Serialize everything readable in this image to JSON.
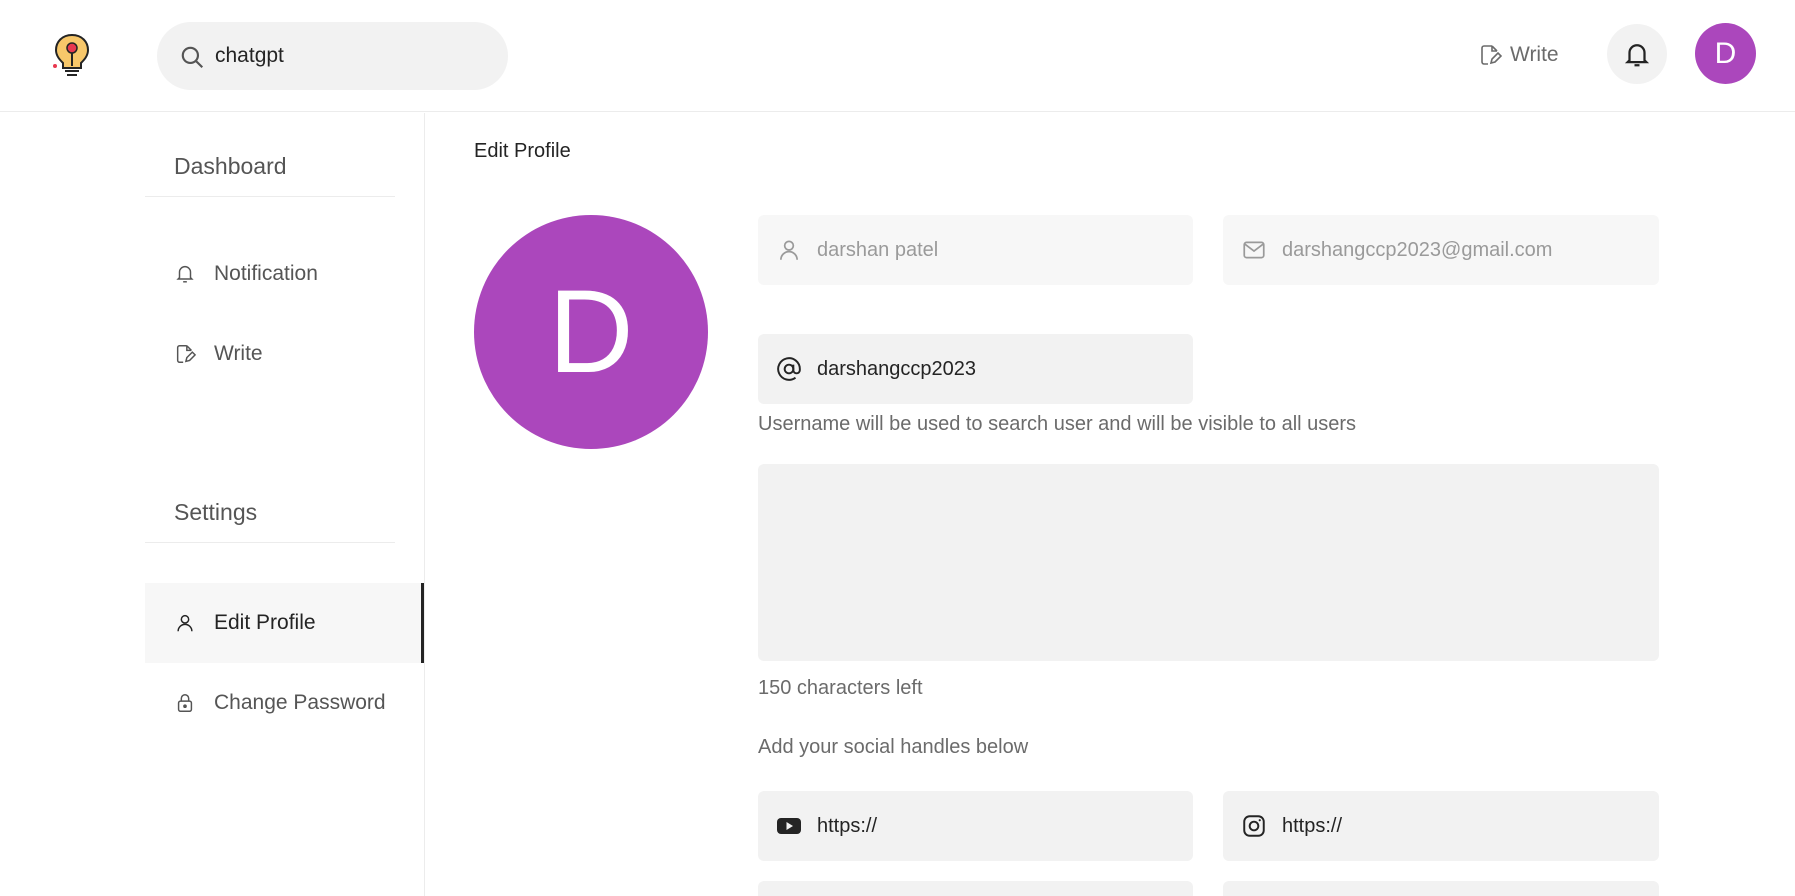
{
  "header": {
    "search": {
      "value": "chatgpt",
      "placeholder": "Search"
    },
    "write_label": "Write",
    "avatar_initial": "D"
  },
  "sidebar": {
    "dashboard_heading": "Dashboard",
    "dashboard_items": [
      {
        "label": "Notification",
        "icon": "bell-icon"
      },
      {
        "label": "Write",
        "icon": "write-icon"
      }
    ],
    "settings_heading": "Settings",
    "settings_items": [
      {
        "label": "Edit Profile",
        "icon": "user-icon",
        "active": true
      },
      {
        "label": "Change Password",
        "icon": "lock-icon",
        "active": false
      }
    ]
  },
  "main": {
    "title": "Edit Profile",
    "avatar_initial": "D",
    "fullname": "darshan patel",
    "email": "darshangccp2023@gmail.com",
    "username": "darshangccp2023",
    "username_hint": "Username will be used to search user and will be visible to all users",
    "bio": "",
    "chars_left": "150 characters left",
    "social_heading": "Add your social handles below",
    "social": [
      {
        "platform": "youtube",
        "icon": "youtube-icon",
        "value": "https://"
      },
      {
        "platform": "instagram",
        "icon": "instagram-icon",
        "value": "https://"
      }
    ]
  },
  "colors": {
    "accent_avatar": "#ab47bc",
    "field_bg": "#f2f2f2",
    "text_primary": "#242424",
    "text_secondary": "#6b6b6b"
  }
}
